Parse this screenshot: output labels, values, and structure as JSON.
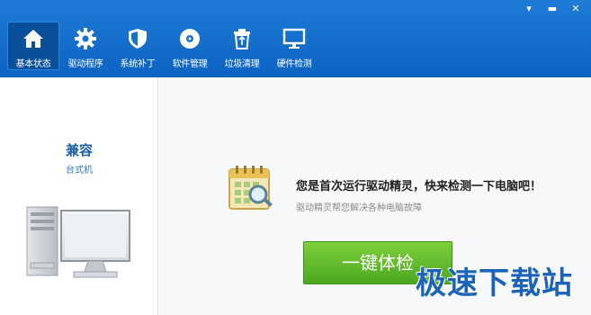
{
  "window_controls": {
    "menu": "▾",
    "minimize": "▬",
    "close": "✕"
  },
  "nav": {
    "items": [
      {
        "label": "基本状态",
        "icon": "home-icon",
        "active": true
      },
      {
        "label": "驱动程序",
        "icon": "gear-icon",
        "active": false
      },
      {
        "label": "系统补丁",
        "icon": "shield-icon",
        "active": false
      },
      {
        "label": "软件管理",
        "icon": "disc-icon",
        "active": false
      },
      {
        "label": "垃圾清理",
        "icon": "trash-icon",
        "active": false
      },
      {
        "label": "硬件检测",
        "icon": "monitor-icon",
        "active": false
      }
    ]
  },
  "left_panel": {
    "title": "兼容",
    "subtitle": "台式机"
  },
  "main": {
    "headline": "您是首次运行驱动精灵，快来检测一下电脑吧！",
    "subline": "驱动精灵帮您解决各种电脑故障",
    "check_button": "一键体检"
  },
  "watermark": "极速下载站",
  "colors": {
    "topbar": "#1571cc",
    "active_tab": "#0a4f9a",
    "button_green": "#5cb82a",
    "title_blue": "#1c5fa6"
  }
}
